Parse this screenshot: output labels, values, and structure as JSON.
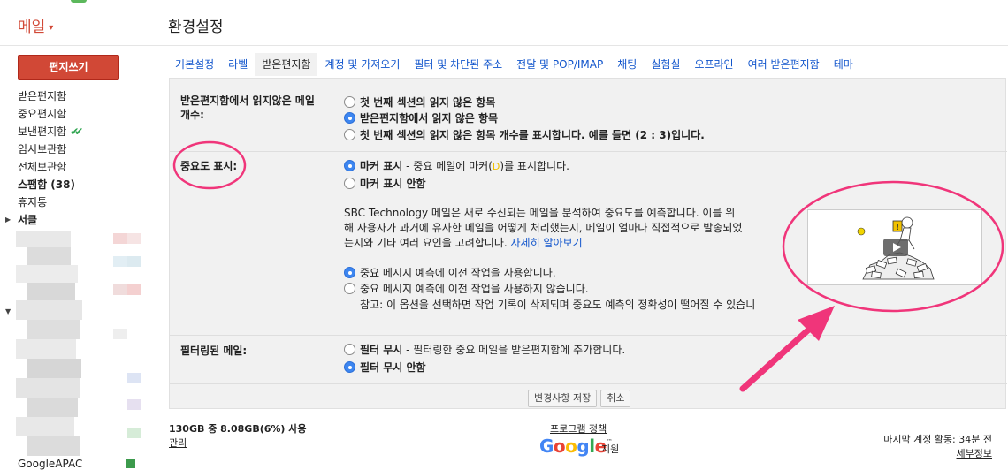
{
  "header": {
    "app_title": "메일",
    "app_title_caret": "▾",
    "page_title": "환경설정"
  },
  "sidebar": {
    "compose_label": "편지쓰기",
    "items": [
      {
        "label": "받은편지함"
      },
      {
        "label": "중요편지함"
      },
      {
        "label": "보낸편지함",
        "check": "✔✔"
      },
      {
        "label": "임시보관함"
      },
      {
        "label": "전체보관함"
      },
      {
        "label": "스팸함 (38)",
        "bold": true
      },
      {
        "label": "휴지통"
      },
      {
        "label": "서클",
        "bold": true,
        "arrow": "▶"
      }
    ],
    "collapse_caret": "▼",
    "bottom_label": "GoogleAPAC"
  },
  "tabs": [
    {
      "label": "기본설정"
    },
    {
      "label": "라벨"
    },
    {
      "label": "받은편지함",
      "active": true
    },
    {
      "label": "계정 및 가져오기"
    },
    {
      "label": "필터 및 차단된 주소"
    },
    {
      "label": "전달 및 POP/IMAP"
    },
    {
      "label": "채팅"
    },
    {
      "label": "실험실"
    },
    {
      "label": "오프라인"
    },
    {
      "label": "여러 받은편지함"
    },
    {
      "label": "테마"
    }
  ],
  "unread": {
    "label_line1": "받은편지함에서 읽지않은 메일",
    "label_line2": "개수:",
    "options": [
      {
        "label": "첫 번째 섹션의 읽지 않은 항목",
        "checked": false
      },
      {
        "label": "받은편지함에서 읽지 않은 항목",
        "checked": true
      },
      {
        "label": "첫 번째 섹션의 읽지 않은 항목 개수를 표시합니다. 예를 들면 (2 : 3)입니다.",
        "checked": false
      }
    ]
  },
  "importance": {
    "label": "중요도 표시:",
    "marker_on_bold": "마커 표시",
    "marker_on_rest_before": " - 중요 메일에 마커(",
    "marker_symbol": "D",
    "marker_on_rest_after": ")를 표시합니다.",
    "marker_off": "마커 표시 안함",
    "desc_line1": "SBC Technology 메일은 새로 수신되는 메일을 분석하여 중요도를 예측합니다. 이를 위",
    "desc_line2": "해 사용자가 과거에 유사한 메일을 어떻게 처리했는지, 메일이 얼마나 직접적으로 발송되었",
    "desc_line3": "는지와 기타 여러 요인을 고려합니다.",
    "learn_more": "자세히 알아보기",
    "past_on": "중요 메시지 예측에 이전 작업을 사용합니다.",
    "past_off": "중요 메시지 예측에 이전 작업을 사용하지 않습니다.",
    "note": "참고: 이 옵션을 선택하면 작업 기록이 삭제되며 중요도 예측의 정확성이 떨어질 수 있습니"
  },
  "filtered": {
    "label": "필터링된 메일:",
    "ignore_bold": "필터 무시",
    "ignore_rest": " - 필터링한 중요 메일을 받은편지함에 추가합니다.",
    "no_ignore": "필터 무시 안함"
  },
  "buttons": {
    "save": "변경사항 저장",
    "cancel": "취소"
  },
  "footer": {
    "storage": "130GB 중 8.08GB(6%) 사용",
    "manage": "관리",
    "policy": "프로그램 정책",
    "google_tm": "™",
    "support": "지원",
    "last_activity": "마지막 계정 활동: 34분 전",
    "details": "세부정보"
  },
  "colors": {
    "brand_red": "#d14836",
    "link_blue": "#1155cc",
    "annotation_pink": "#f0357a"
  }
}
